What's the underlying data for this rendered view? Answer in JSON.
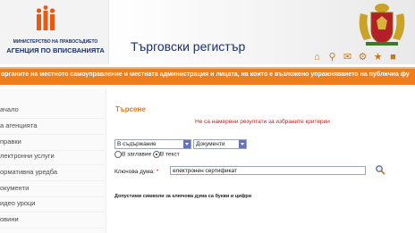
{
  "header": {
    "ministry": "МИНИСТЕРСТВО НА ПРАВОСЪДИЕТО",
    "agency": "АГЕНЦИЯ ПО ВПИСВАНИЯТА",
    "site_title": "Търговски регистър",
    "toolbar_icons": [
      "home-icon",
      "search-icon",
      "mail-icon",
      "sitemap-icon",
      "help-icon",
      "map-icon"
    ]
  },
  "banner": {
    "text": "органите на местното самоуправление и местната администрация и лицата, на които е възложено упражняването на публична фу"
  },
  "sidebar": {
    "items": [
      {
        "label": "ачало"
      },
      {
        "label": "а агенцията"
      },
      {
        "label": "правки"
      },
      {
        "label": "лектронни услуги"
      },
      {
        "label": "ормативна уредба"
      },
      {
        "label": "окументи"
      },
      {
        "label": "идео уроци"
      },
      {
        "label": "овини"
      }
    ]
  },
  "search": {
    "title": "Търсене",
    "no_results": "Не са намерени резултати за избраните критерии",
    "scope_select": "В съдържание",
    "type_select": "Документи",
    "radio_title": "В заглавие",
    "radio_text": "В текст",
    "radio_selected": "text",
    "keyword_label": "Ключова дума:",
    "keyword_required": "*",
    "keyword_value": "електронен сертификат",
    "hint": "Допустими символи за ключова дума са букви и цифри"
  },
  "colors": {
    "accent": "#f07d1c",
    "brand_blue": "#1c2f6b",
    "error_red": "#c21d1d"
  }
}
